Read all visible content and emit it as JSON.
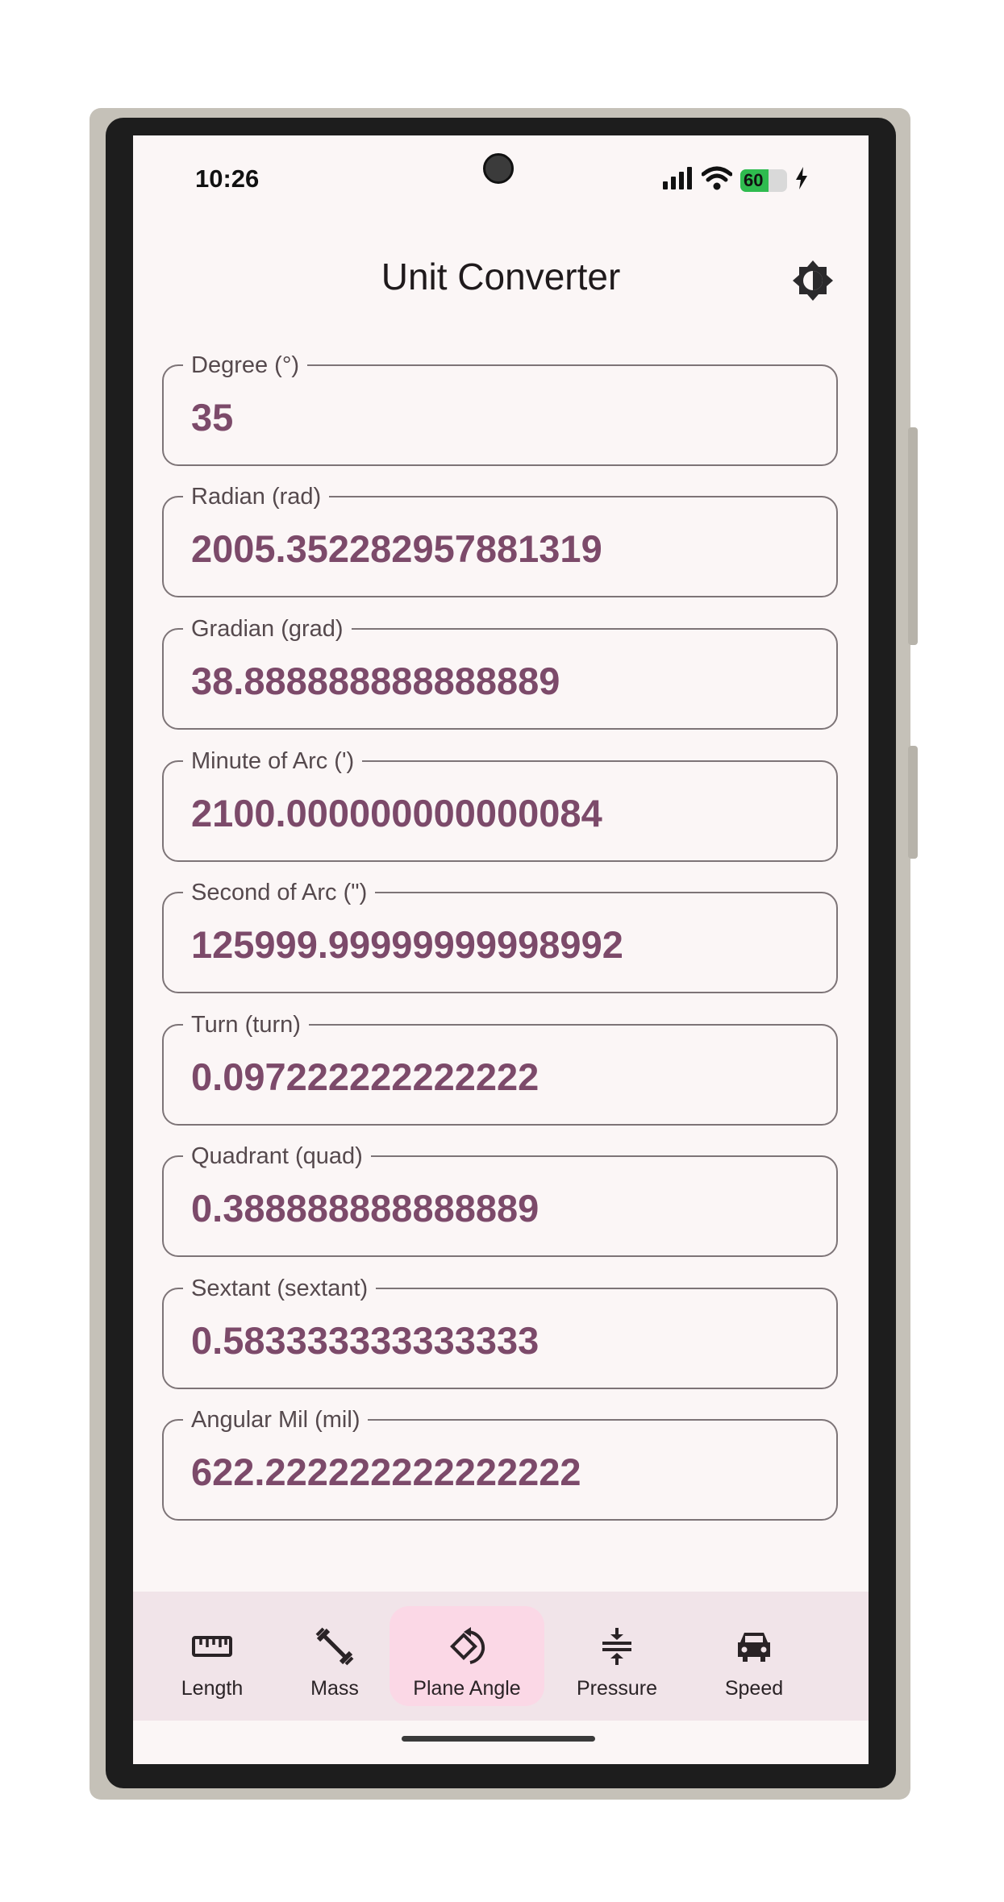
{
  "status_bar": {
    "time": "10:26",
    "battery": "60"
  },
  "app": {
    "title": "Unit Converter"
  },
  "fields": [
    {
      "label": "Degree (°)",
      "value": "35"
    },
    {
      "label": "Radian (rad)",
      "value": "2005.352282957881319"
    },
    {
      "label": "Gradian (grad)",
      "value": "38.888888888888889"
    },
    {
      "label": "Minute of Arc (')",
      "value": "2100.000000000000084"
    },
    {
      "label": "Second of Arc (\")",
      "value": "125999.99999999998992"
    },
    {
      "label": "Turn (turn)",
      "value": "0.097222222222222"
    },
    {
      "label": "Quadrant (quad)",
      "value": "0.388888888888889"
    },
    {
      "label": "Sextant (sextant)",
      "value": "0.583333333333333"
    },
    {
      "label": "Angular Mil (mil)",
      "value": "622.222222222222222"
    }
  ],
  "nav": {
    "items": [
      {
        "label": "Length",
        "icon": "ruler-icon"
      },
      {
        "label": "Mass",
        "icon": "dumbbell-icon"
      },
      {
        "label": "Plane Angle",
        "icon": "rotate-angle-icon"
      },
      {
        "label": "Pressure",
        "icon": "compress-icon"
      },
      {
        "label": "Speed",
        "icon": "car-icon"
      }
    ],
    "active": "Plane Angle"
  },
  "colors": {
    "accent": "#7c4a6a",
    "nav_background": "#f1e4e9",
    "nav_active": "#fbd8e6",
    "screen_background": "#fbf6f6",
    "battery": "#2fbb4f"
  }
}
